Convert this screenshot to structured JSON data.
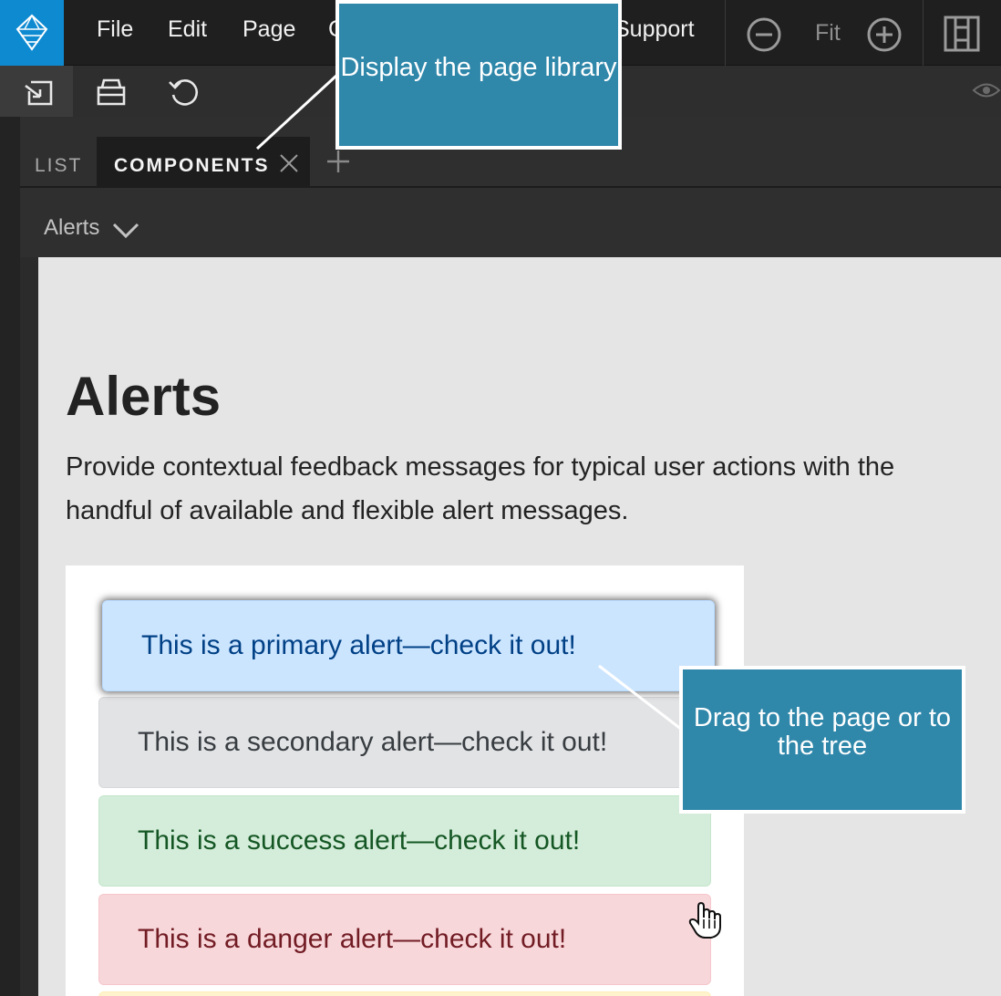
{
  "menu": {
    "items": [
      "File",
      "Edit",
      "Page",
      "C",
      "Support"
    ],
    "zoom_label": "Fit"
  },
  "tabs": {
    "list_label": "LIST",
    "components_label": "COMPONENTS"
  },
  "library": {
    "dropdown_value": "Alerts"
  },
  "canvas": {
    "heading": "Alerts",
    "lead": "Provide contextual feedback messages for typical user actions with the handful of available and flexible alert messages.",
    "alerts": {
      "primary": "This is a primary alert—check it out!",
      "secondary": "This is a secondary alert—check it out!",
      "success": "This is a success alert—check it out!",
      "danger": "This is a danger alert—check it out!"
    }
  },
  "callouts": {
    "library": "Display the page library",
    "drag": "Drag to the page or to the tree"
  },
  "colors": {
    "accent": "#0e8ad1",
    "callout": "#2f87aa",
    "primary_bg": "#cce5ff",
    "secondary_bg": "#e2e3e5",
    "success_bg": "#d4edda",
    "danger_bg": "#f8d7da"
  }
}
